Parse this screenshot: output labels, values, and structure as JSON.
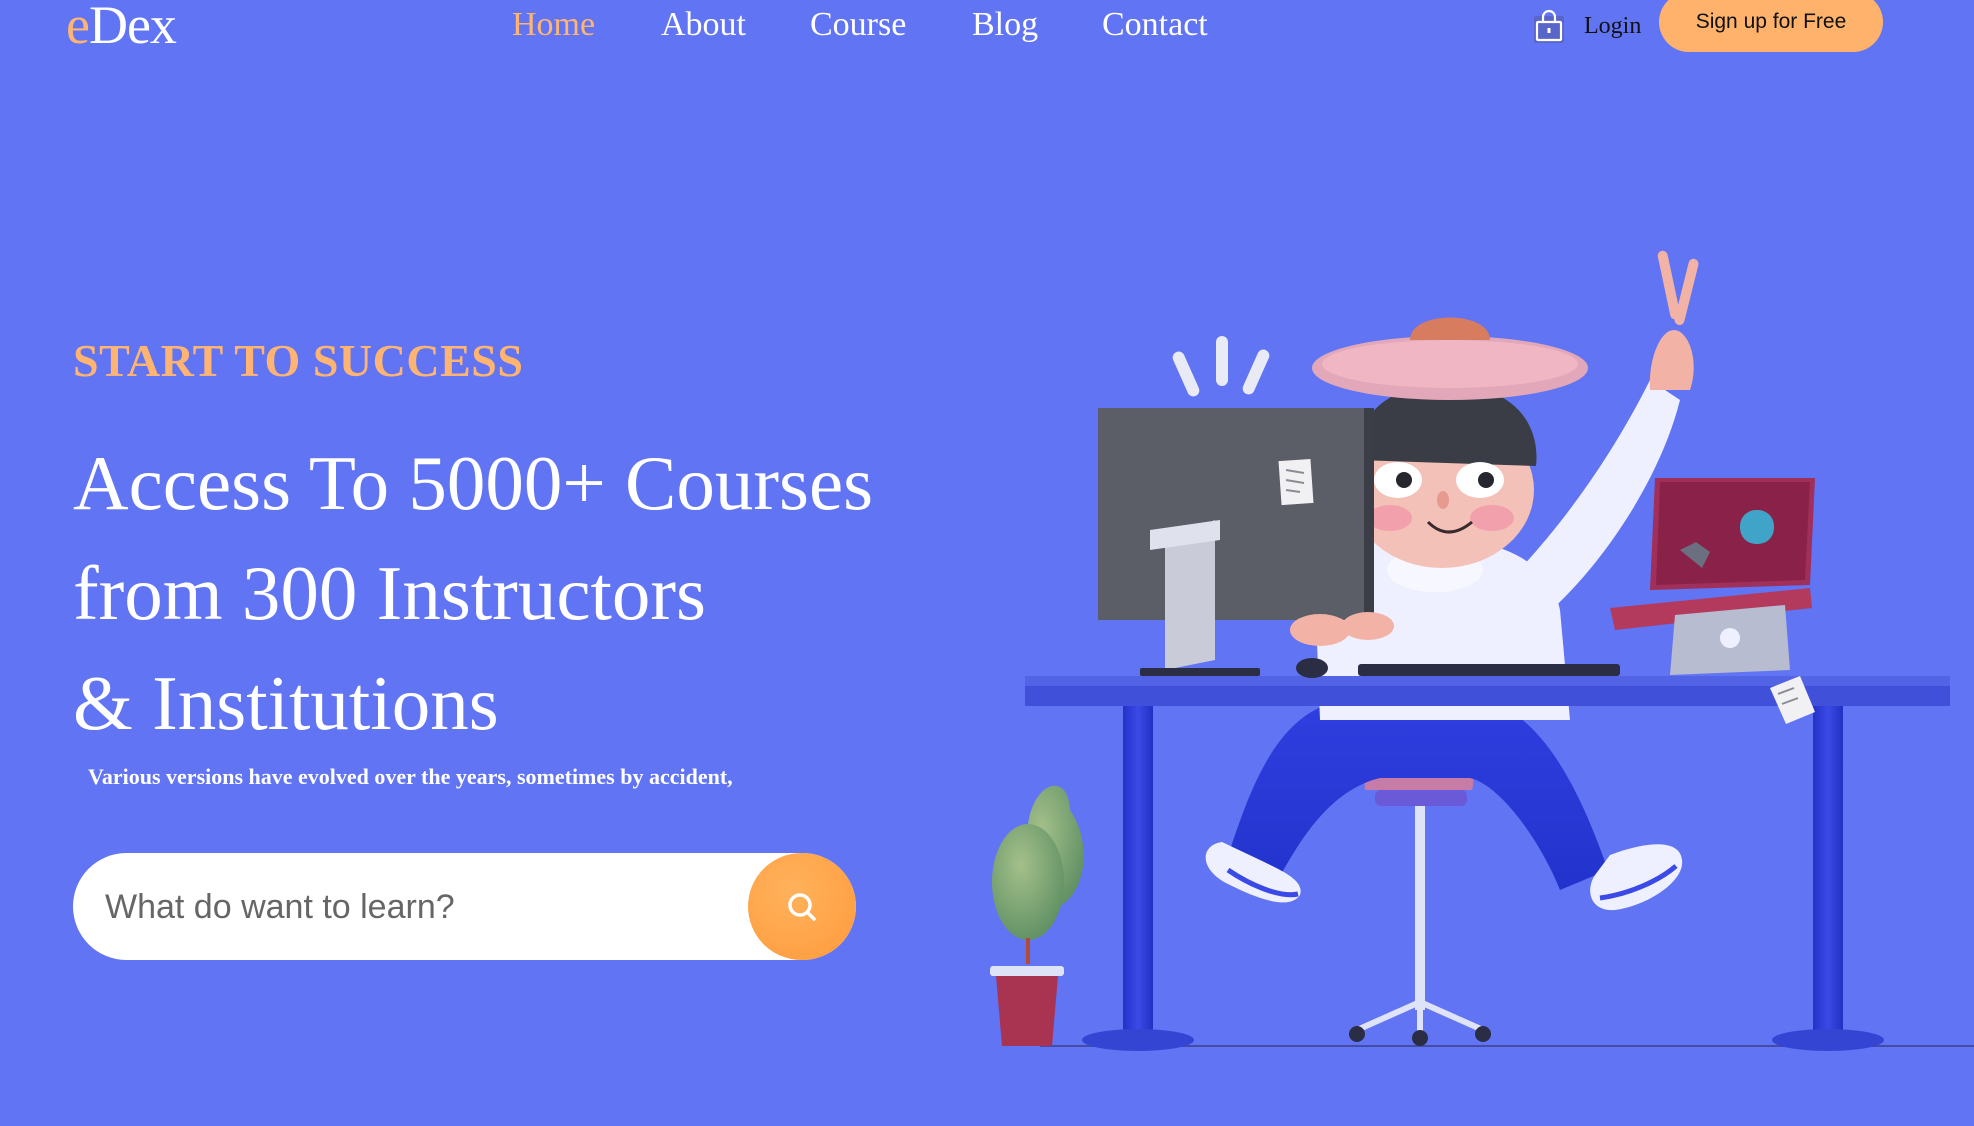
{
  "brand": {
    "first_letter": "e",
    "rest": "Dex"
  },
  "nav": {
    "items": [
      {
        "label": "Home",
        "active": true
      },
      {
        "label": "About",
        "active": false
      },
      {
        "label": "Course",
        "active": false
      },
      {
        "label": "Blog",
        "active": false
      },
      {
        "label": "Contact",
        "active": false
      }
    ]
  },
  "auth": {
    "login_label": "Login",
    "signup_label": "Sign up for Free"
  },
  "hero": {
    "eyebrow": "START TO SUCCESS",
    "headline_lines": [
      "Access To 5000+ Courses",
      "from 300 Instructors",
      "& Institutions"
    ],
    "subtext": "Various versions have evolved over the years, sometimes by accident,"
  },
  "search": {
    "placeholder": "What do want to learn?",
    "value": ""
  },
  "icons": {
    "login": "lock-icon",
    "search": "search-icon"
  },
  "colors": {
    "background": "#6174f3",
    "accent": "#ffb571",
    "button": "#ffb26b",
    "text": "#ffffff"
  }
}
